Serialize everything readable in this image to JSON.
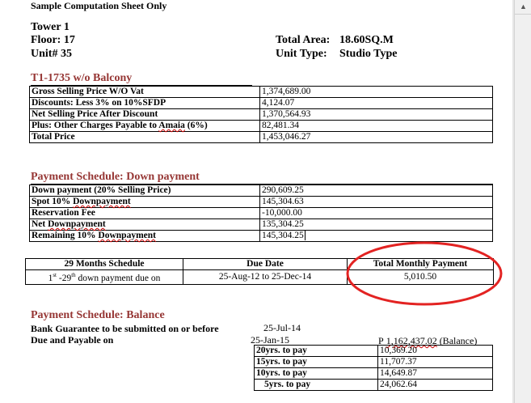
{
  "title": "Sample Computation Sheet Only",
  "unit": {
    "tower": "Tower 1",
    "floor": "Floor: 17",
    "unit_no": "Unit# 35",
    "area_label": "Total Area:",
    "area_value": "18.60SQ.M",
    "type_label": "Unit Type:",
    "type_value": "Studio Type"
  },
  "pricing": {
    "heading": "T1-1735 w/o Balcony",
    "rows": [
      {
        "label": "Gross Selling Price W/O Vat",
        "value": "1,374,689.00"
      },
      {
        "label": "Discounts: Less 3% on 10%SFDP",
        "value": "4,124.07"
      },
      {
        "label": "Net Selling Price After Discount",
        "value": "1,370,564.93"
      },
      {
        "label_a": "Plus: Other Charges Payable to ",
        "label_b": "Amaia",
        "label_c": "  (6%)",
        "value": "82,481.34"
      },
      {
        "label": "Total Price",
        "value": "1,453,046.27"
      }
    ]
  },
  "downpayment": {
    "heading": "Payment Schedule: Down payment",
    "rows": [
      {
        "label": "Down payment   (20% Selling Price)",
        "value": "290,609.25"
      },
      {
        "label_a": "Spot 10% ",
        "label_b": "Downpayment",
        "value": "145,304.63"
      },
      {
        "label": "Reservation Fee",
        "value": "-10,000.00"
      },
      {
        "label_a": "Net ",
        "label_b": "Downpayment",
        "value": "135,304.25"
      },
      {
        "label_a": "Remaining 10% ",
        "label_b": "Downpayment",
        "value": "145,304.25"
      }
    ]
  },
  "schedule": {
    "headers": [
      "29 Months Schedule",
      "Due Date",
      "Total Monthly Payment"
    ],
    "row": {
      "col1_a": "1",
      "col1_sup": "st",
      "col1_b": " -29",
      "col1_sup2": "th",
      "col1_c": "  down payment due on",
      "due": "25-Aug-12  to  25-Dec-14",
      "monthly": "5,010.50"
    }
  },
  "balance": {
    "heading": "Payment Schedule: Balance",
    "guarantee_label": "Bank Guarantee to be submitted on or before",
    "guarantee_date": "25-Jul-14",
    "due_label": "Due and Payable on",
    "due_date": "25-Jan-15",
    "balance_prefix": "P",
    "balance_amount": "1,162,437.02",
    "balance_suffix": " (Balance)",
    "terms": [
      {
        "label": "20yrs. to pay",
        "value": "10,369.20"
      },
      {
        "label": "15yrs. to pay",
        "value": "11,707.37"
      },
      {
        "label": "10yrs. to pay",
        "value": "14,649.87"
      },
      {
        "label": "5yrs. to pay",
        "value": "24,062.64"
      }
    ]
  },
  "colors": {
    "section_heading": "#963634",
    "highlight_ellipse": "#e32322"
  }
}
